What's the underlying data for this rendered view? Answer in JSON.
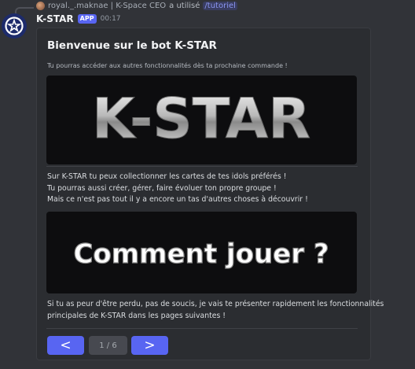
{
  "reply": {
    "username": "royal._.maknae | K-Space CEO",
    "action": "a utilisé",
    "command": "tutoriel"
  },
  "message": {
    "username": "K-STAR",
    "badge": "APP",
    "time": "00:17"
  },
  "embed": {
    "title": "Bienvenue sur le bot K-STAR",
    "subtitle": "Tu pourras accéder aux autres fonctionnalités dès ta prochaine commande !",
    "logo_text": "K-STAR",
    "intro_lines": [
      "Sur K-STAR tu peux collectionner les cartes de tes idols préférés !",
      "Tu pourras aussi créer, gérer, faire évoluer ton propre groupe !",
      "Mais ce n'est pas tout il y a encore un tas d'autres choses à découvrir !"
    ],
    "howto_text": "Comment jouer ?",
    "outro_lines": [
      "Si tu as peur d'être perdu, pas de soucis, je vais te présenter rapidement les fonctionnalités",
      "principales de K-STAR dans les pages suivantes !"
    ]
  },
  "pagination": {
    "prev_icon": "chevron-left-icon",
    "next_icon": "chevron-right-icon",
    "prev_label": "<",
    "next_label": ">",
    "page_label": "1 / 6"
  },
  "colors": {
    "background": "#313338",
    "embed_bg": "#2b2d31",
    "blurple": "#5865f2",
    "command": "#8a95f0"
  }
}
